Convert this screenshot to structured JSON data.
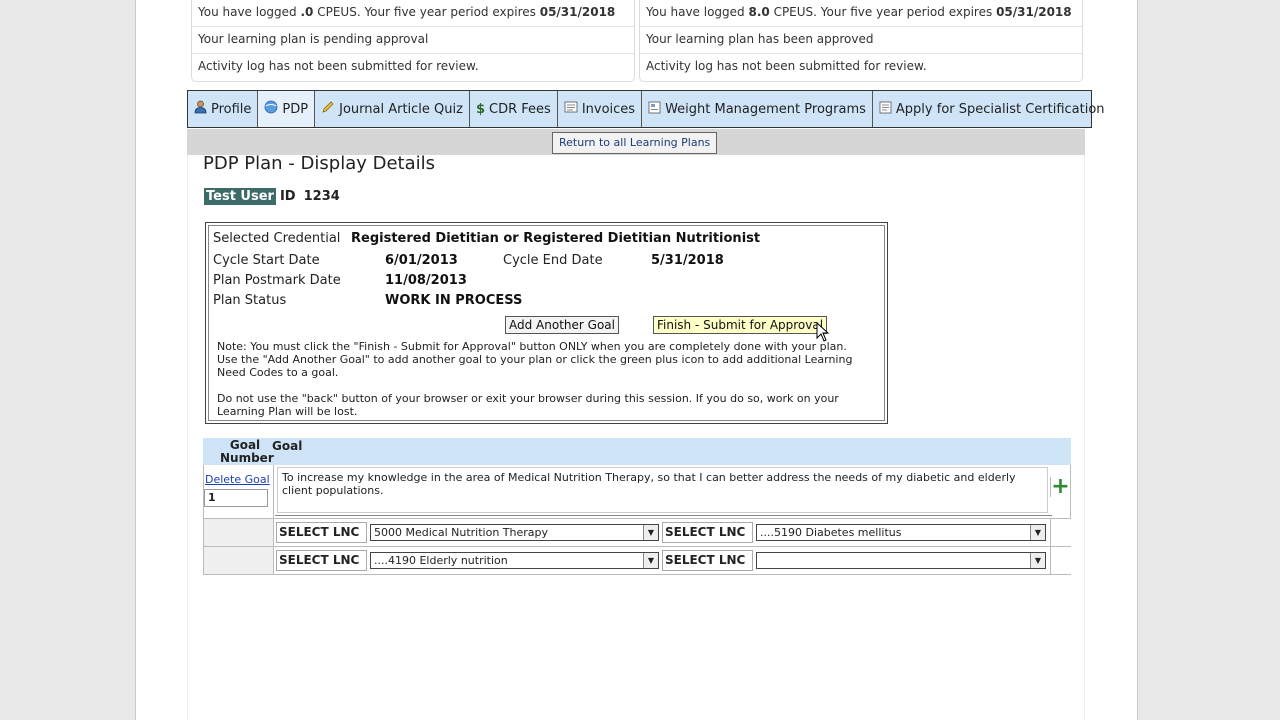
{
  "status": {
    "left": {
      "cpeu_prefix": "You have logged ",
      "cpeu_value": ".0",
      "cpeu_mid": " CPEUS.  Your five year period expires ",
      "expires": "05/31/2018",
      "plan_status": "Your learning plan is pending approval",
      "activity": "Activity log has not been submitted for review."
    },
    "right": {
      "cpeu_prefix": "You have logged ",
      "cpeu_value": "8.0",
      "cpeu_mid": " CPEUS.  Your five year period expires ",
      "expires": "05/31/2018",
      "plan_status": "Your learning plan has been approved",
      "activity": "Activity log has not been submitted for review."
    }
  },
  "nav": {
    "tabs": [
      {
        "label": "Profile",
        "icon": "person-icon"
      },
      {
        "label": "PDP",
        "icon": "globe-icon"
      },
      {
        "label": "Journal Article Quiz",
        "icon": "pencil-icon"
      },
      {
        "label": "CDR Fees",
        "icon": "dollar-icon"
      },
      {
        "label": "Invoices",
        "icon": "document-icon"
      },
      {
        "label": "Weight Management Programs",
        "icon": "form-icon"
      },
      {
        "label": "Apply for Specialist Certification",
        "icon": "form-icon"
      }
    ],
    "active": "PDP"
  },
  "return_button": "Return to all Learning Plans",
  "page_title": "PDP Plan - Display Details",
  "user": {
    "name": "Test User",
    "id_label": "ID",
    "id_value": "1234"
  },
  "details": {
    "credential_label": "Selected Credential",
    "credential_value": "Registered Dietitian or Registered Dietitian Nutritionist",
    "cycle_start_label": "Cycle Start Date",
    "cycle_start_value": "6/01/2013",
    "cycle_end_label": "Cycle End Date",
    "cycle_end_value": "5/31/2018",
    "postmark_label": "Plan Postmark Date",
    "postmark_value": "11/08/2013",
    "status_label": "Plan Status",
    "status_value": "WORK IN PROCESS",
    "add_goal_button": "Add Another Goal",
    "finish_button": "Finish - Submit for Approval",
    "note1_line1": "Note: You must click the \"Finish - Submit for Approval\" button ONLY when you are completely done with your plan.",
    "note1_line2": "Use the \"Add Another Goal\" to add another goal to your plan or click the green plus icon to add additional Learning",
    "note1_line3": "Need Codes to a goal.",
    "note2_line1": "Do not use the \"back\" button of your browser or exit your browser during this session.  If you do so, work on your",
    "note2_line2": "Learning Plan will be lost."
  },
  "goals": {
    "header_number": "Goal Number",
    "header_goal": "Goal",
    "delete_link": "Delete Goal",
    "number": "1",
    "text": "To increase my knowledge in the area of Medical Nutrition Therapy, so that I can better address the needs of my diabetic and elderly client populations.",
    "plus_icon": "plus-icon",
    "lnc_label": "SELECT LNC",
    "lnc_rows": [
      {
        "first": "5000 Medical Nutrition Therapy",
        "second": "....5190 Diabetes mellitus"
      },
      {
        "first": "....4190 Elderly nutrition",
        "second": ""
      }
    ]
  }
}
